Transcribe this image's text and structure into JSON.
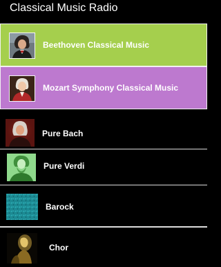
{
  "app": {
    "title": "Classical Music Radio"
  },
  "stations": [
    {
      "label": "Beethoven Classical Music",
      "color": "#a5cf4d",
      "icon": "beethoven-portrait-icon"
    },
    {
      "label": "Mozart Symphony Classical Music",
      "color": "#bd79cf",
      "icon": "mozart-portrait-icon"
    },
    {
      "label": "Pure Bach",
      "icon": "bach-portrait-icon"
    },
    {
      "label": "Pure Verdi",
      "icon": "verdi-portrait-icon"
    },
    {
      "label": "Barock",
      "icon": "teal-texture-icon"
    },
    {
      "label": "Chor",
      "icon": "choir-silhouette-icon"
    }
  ]
}
